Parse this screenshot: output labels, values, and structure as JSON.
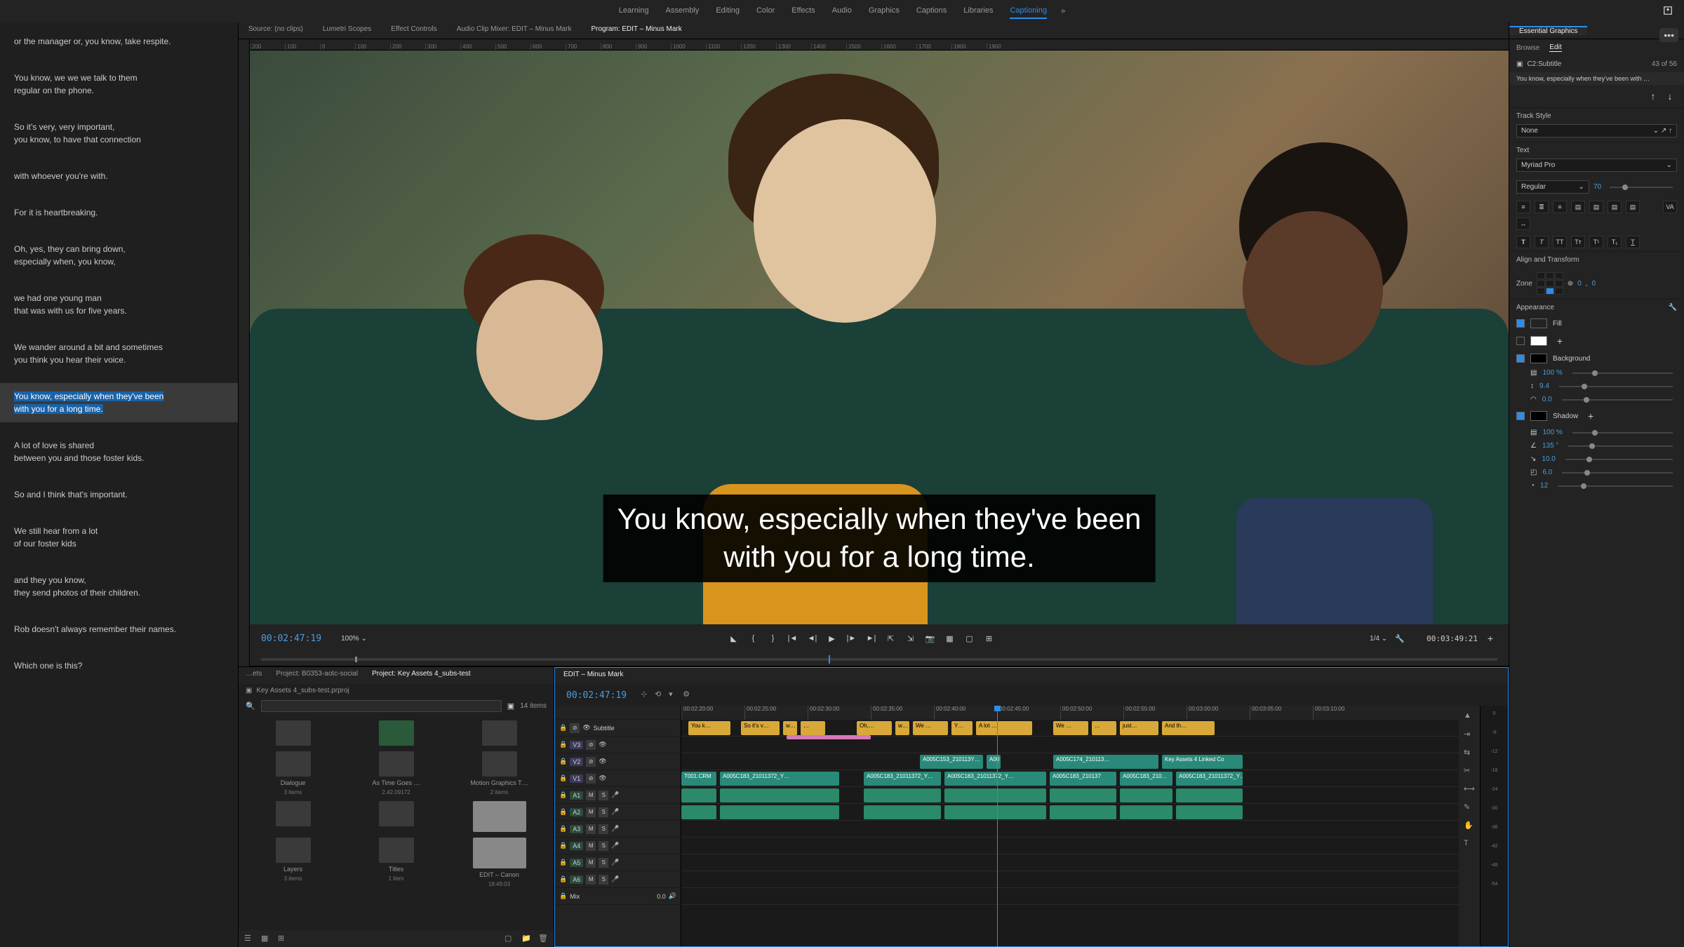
{
  "workspaces": [
    "Learning",
    "Assembly",
    "Editing",
    "Color",
    "Effects",
    "Audio",
    "Graphics",
    "Captions",
    "Libraries",
    "Captioning"
  ],
  "active_workspace": "Captioning",
  "source_tabs": {
    "source": "Source: (no clips)",
    "lumetri": "Lumetri Scopes",
    "effect": "Effect Controls",
    "mixer": "Audio Clip Mixer: EDIT – Minus Mark",
    "program": "Program: EDIT – Minus Mark"
  },
  "captions": [
    "or the manager or, you know, take respite.",
    "You know, we we we talk to them\nregular on the phone.",
    "So it's very, very important,\nyou know, to have that connection",
    "with whoever you're with.",
    "For it is heartbreaking.",
    "Oh, yes, they can bring down,\nespecially when, you know,",
    "we had one young man\nthat was with us for five years.",
    "We wander around a bit and sometimes\nyou think you hear their voice.",
    "You know, especially when they've been\nwith you for a long time.",
    "A lot of love is shared\nbetween you and those foster kids.",
    "So and I think that's important.",
    "We still hear from a lot\nof our foster kids",
    "and they you know,\nthey send photos of their children.",
    "Rob doesn't always remember their names.",
    "Which one is this?"
  ],
  "selected_caption_index": 8,
  "subtitle_text": "You know, especially when they've been\nwith you for a long time.",
  "program": {
    "tc_left": "00:02:47:19",
    "zoom": "100%",
    "fit": "1/4",
    "tc_right": "00:03:49:21"
  },
  "project": {
    "tabs": [
      "…ets",
      "Project: B0353-aotc-social",
      "Project: Key Assets 4_subs-test"
    ],
    "active_tab": 2,
    "file": "Key Assets 4_subs-test.prproj",
    "item_count": "14 items",
    "bins": [
      {
        "name": "",
        "type": "folder"
      },
      {
        "name": "",
        "type": "wav"
      },
      {
        "name": "",
        "type": "folder"
      },
      {
        "name": "Dialogue",
        "meta": "3 items",
        "type": "folder"
      },
      {
        "name": "As Time Goes …",
        "meta": "2.42.09172",
        "type": "folder"
      },
      {
        "name": "Motion Graphics T…",
        "meta": "2 items",
        "type": "folder"
      },
      {
        "name": "",
        "type": "folder"
      },
      {
        "name": "",
        "type": "folder"
      },
      {
        "name": "",
        "type": "thumb"
      },
      {
        "name": "Layers",
        "meta": "3 items",
        "type": "folder"
      },
      {
        "name": "Titles",
        "meta": "1 item",
        "type": "folder"
      },
      {
        "name": "EDIT – Canon",
        "meta": "18:49:03",
        "type": "thumb"
      }
    ]
  },
  "timeline": {
    "name": "EDIT – Minus Mark",
    "tc": "00:02:47:19",
    "ruler": [
      "00:02:20:00",
      "00:02:25:00",
      "00:02:30:00",
      "00:02:35:00",
      "00:02:40:00",
      "00:02:45:00",
      "00:02:50:00",
      "00:02:55:00",
      "00:03:00:00",
      "00:03:05:00",
      "00:03:10:00"
    ],
    "subtitle_track": "Subtitle",
    "tracks_v": [
      "V3",
      "V2",
      "V1"
    ],
    "tracks_a": [
      "A1",
      "A2",
      "A3",
      "A4",
      "A5",
      "A6"
    ],
    "mix": "Mix",
    "mix_val": "0.0",
    "sub_clips": [
      [
        "You k…",
        10,
        70
      ],
      [
        "So it's v…",
        85,
        140
      ],
      [
        "w…",
        145,
        165
      ],
      [
        "…",
        170,
        205
      ],
      [
        "Oh,…",
        250,
        300
      ],
      [
        "w…",
        305,
        325
      ],
      [
        "We …",
        330,
        380
      ],
      [
        "Y…",
        385,
        415
      ],
      [
        "A lot …",
        420,
        500
      ],
      [
        "We …",
        530,
        580
      ],
      [
        "…",
        585,
        620
      ],
      [
        "just…",
        625,
        680
      ],
      [
        "And th…",
        685,
        760
      ]
    ],
    "v2_clips": [
      [
        "A005C153_210113Y…",
        340,
        430
      ],
      [
        "A00",
        435,
        455
      ],
      [
        "A005C174_210113…",
        530,
        680
      ],
      [
        "Key Assets 4 Linked Co",
        685,
        800
      ]
    ],
    "v1_clips": [
      [
        "T001.CRM",
        0,
        50
      ],
      [
        "A005C183_21011372_Y…",
        55,
        225
      ],
      [
        "A005C183_21011372_Y…",
        260,
        370
      ],
      [
        "A005C183_21011372_Y…",
        375,
        520
      ],
      [
        "A005C183_210137",
        525,
        620
      ],
      [
        "A005C183_210…",
        625,
        700
      ],
      [
        "A005C183_21011372_Y…",
        705,
        800
      ]
    ]
  },
  "essential_graphics": {
    "title": "Essential Graphics",
    "tabs": [
      "Browse",
      "Edit"
    ],
    "active_tab": "Edit",
    "layer": "C2:Subtitle",
    "counter": "43 of 56",
    "preview": "You know, especially when they've been with …",
    "track_style_label": "Track Style",
    "track_style": "None",
    "text_label": "Text",
    "font": "Myriad Pro",
    "weight": "Regular",
    "size": "70",
    "align_label": "Align and Transform",
    "zone_label": "Zone",
    "pos_x": "0",
    "pos_y": "0",
    "appearance_label": "Appearance",
    "fill_label": "Fill",
    "fill_color": "#ffffff",
    "stroke_label": "",
    "stroke_color": "#ffffff",
    "bg_label": "Background",
    "bg_color": "#000000",
    "opacity": "100 %",
    "size_prop": "9.4",
    "radius": "0.0",
    "shadow_label": "Shadow",
    "shadow_color": "#000000",
    "shadow_opacity": "100 %",
    "shadow_angle": "135 °",
    "shadow_dist": "10.0",
    "shadow_size": "6.0",
    "shadow_blur": "12"
  },
  "meters": [
    "0",
    "-6",
    "-12",
    "-18",
    "-24",
    "-30",
    "-36",
    "-42",
    "-48",
    "-54"
  ]
}
